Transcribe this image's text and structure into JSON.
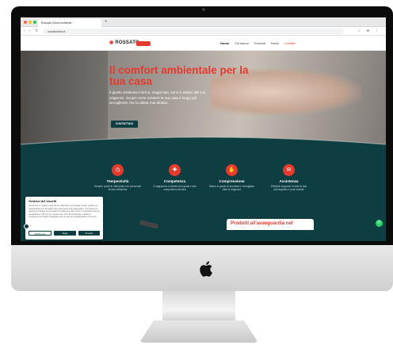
{
  "browser": {
    "tab_title": "Rossato Clima Ambiente...",
    "new_tab": "+",
    "url": "rossatoclima.it",
    "nav_glyphs": "‹ › ↻",
    "toolbar_glyphs": "☆ ⊕ ⋮"
  },
  "site": {
    "logo": "ROSSATO",
    "nav": [
      "Home",
      "Chi siamo",
      "Prodotti",
      "News",
      "Contatti"
    ]
  },
  "hero": {
    "title": "Il comfort ambientale per la tua casa",
    "text": "Il giusto ambiente interno, stagionale, sano e adatto alle tue esigenze. Scopri come rendere la tua casa il luogo più accogliente che tu abbia mai abitato.",
    "cta": "CONTATTACI"
  },
  "features": [
    {
      "icon": "clock-icon",
      "glyph": "◷",
      "title": "Tempestività",
      "desc": "Sempre pronti in intervento con personale tecnico efficiente"
    },
    {
      "icon": "skill-icon",
      "glyph": "✚",
      "title": "Competenza",
      "desc": "Il magazzino a fornitori più giusti e alla competenza tecnica"
    },
    {
      "icon": "handshake-icon",
      "glyph": "✋",
      "title": "Comprensione",
      "desc": "Siamo in grado di ascoltare e consigliare tutte le esigenze"
    },
    {
      "icon": "support-icon",
      "glyph": "✉",
      "title": "Assistenza",
      "desc": "Efficienti supporto in tutte le fasi dell'acquisto e post vendita"
    }
  ],
  "cookie": {
    "title": "Gestisci del Usuefti",
    "text": "Per fornire le migliori esperienze, utilizziamo tecnologie come i cookie per memorizzare e/o accedere alle informazioni del dispositivo. Il consenso a queste tecnologie ci permetterà di elaborare dati come il comportamento di navigazione o ID unici su questo sito. Non acconsentire o ritirare il consenso può influire negativamente su alcune caratteristiche e funzioni.",
    "buttons": [
      "Preferenze",
      "Nega",
      "Accetta"
    ]
  },
  "promo": "Prodotti all'avanguardia nel",
  "colors": {
    "accent": "#e8392d",
    "dark": "#0e3d42"
  }
}
